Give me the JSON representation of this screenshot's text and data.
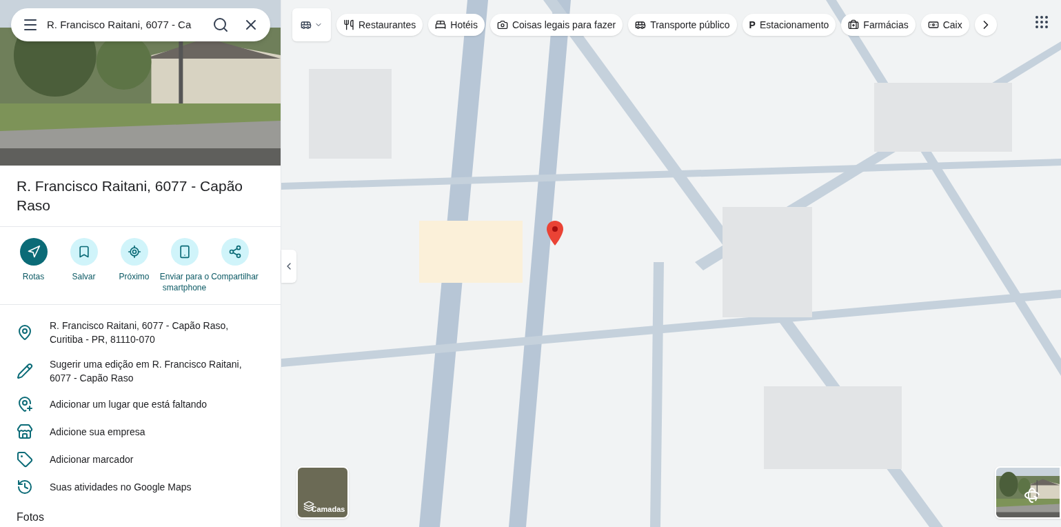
{
  "search": {
    "value": "R. Francisco Raitani, 6077 - Ca"
  },
  "place": {
    "title": "R. Francisco Raitani, 6077 - Capão Raso"
  },
  "actions": [
    {
      "label": "Rotas",
      "kind": "primary"
    },
    {
      "label": "Salvar",
      "kind": "secondary"
    },
    {
      "label": "Próximo",
      "kind": "secondary"
    },
    {
      "label": "Enviar para o smartphone",
      "kind": "secondary"
    },
    {
      "label": "Compartilhar",
      "kind": "secondary"
    }
  ],
  "details": [
    {
      "text": "R. Francisco Raitani, 6077 - Capão Raso, Curitiba - PR, 81110-070"
    },
    {
      "text": "Sugerir uma edição em R. Francisco Raitani, 6077 - Capão Raso"
    },
    {
      "text": "Adicionar um lugar que está faltando"
    },
    {
      "text": "Adicione sua empresa"
    },
    {
      "text": "Adicionar marcador"
    },
    {
      "text": "Suas atividades no Google Maps"
    }
  ],
  "section_heading": "Fotos",
  "chips": [
    {
      "kind": "icon",
      "label": "Restaurantes"
    },
    {
      "kind": "icon",
      "label": "Hotéis"
    },
    {
      "kind": "icon",
      "label": "Coisas legais para fazer"
    },
    {
      "kind": "icon",
      "label": "Transporte público"
    },
    {
      "kind": "glyph",
      "glyph": "P",
      "label": "Estacionamento"
    },
    {
      "kind": "icon",
      "label": "Farmácias"
    },
    {
      "kind": "icon",
      "label": "Caix"
    }
  ],
  "layers_button": "Camadas"
}
